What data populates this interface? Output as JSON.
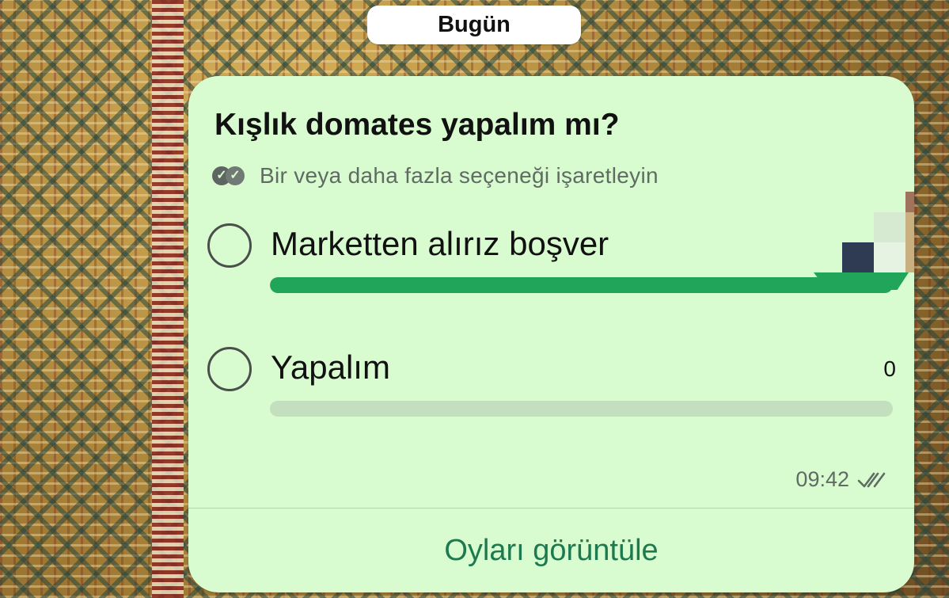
{
  "date_separator": "Bugün",
  "poll": {
    "question": "Kışlık domates yapalım mı?",
    "hint": "Bir veya daha fazla seçeneği işaretleyin",
    "options": [
      {
        "label": "Marketten alırız boşver",
        "vote_fraction": 1.0
      },
      {
        "label": "Yapalım",
        "votes": "0",
        "vote_fraction": 0.0
      }
    ],
    "time": "09:42",
    "view_votes_label": "Oyları görüntüle"
  },
  "colors": {
    "bubble": "#d9fbd0",
    "bar_fill": "#21a55a",
    "bar_track": "#c3dfbd",
    "link": "#1d7a4e"
  },
  "icons": {
    "hint": "double-check-circle-icon",
    "status": "double-tick-icon"
  }
}
